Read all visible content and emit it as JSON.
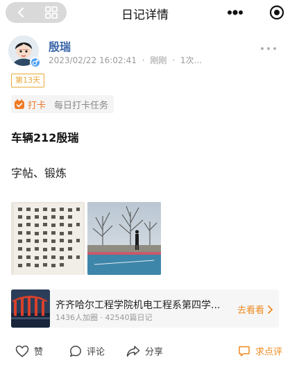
{
  "nav": {
    "title": "日记详情"
  },
  "author": {
    "name": "殷瑞",
    "date": "2023/02/22 16:02:41",
    "relative": "刚刚",
    "views": "1次..."
  },
  "day_badge": "第13天",
  "punch": {
    "tag": "打卡",
    "task": "每日打卡任务"
  },
  "post": {
    "title": "车辆212殷瑞",
    "body": "字帖、锻炼"
  },
  "group": {
    "name": "齐齐哈尔工程学院机电工程系第四学...",
    "stats": "1436人加圈 · 42540篇日记",
    "link": "去看看"
  },
  "actions": {
    "like": "赞",
    "comment": "评论",
    "share": "分享",
    "rate": "求点评"
  },
  "colors": {
    "accent": "#ef8a1f",
    "name": "#3a66a8",
    "badge": "#e8a73a",
    "gender": "#4a9ff5"
  }
}
